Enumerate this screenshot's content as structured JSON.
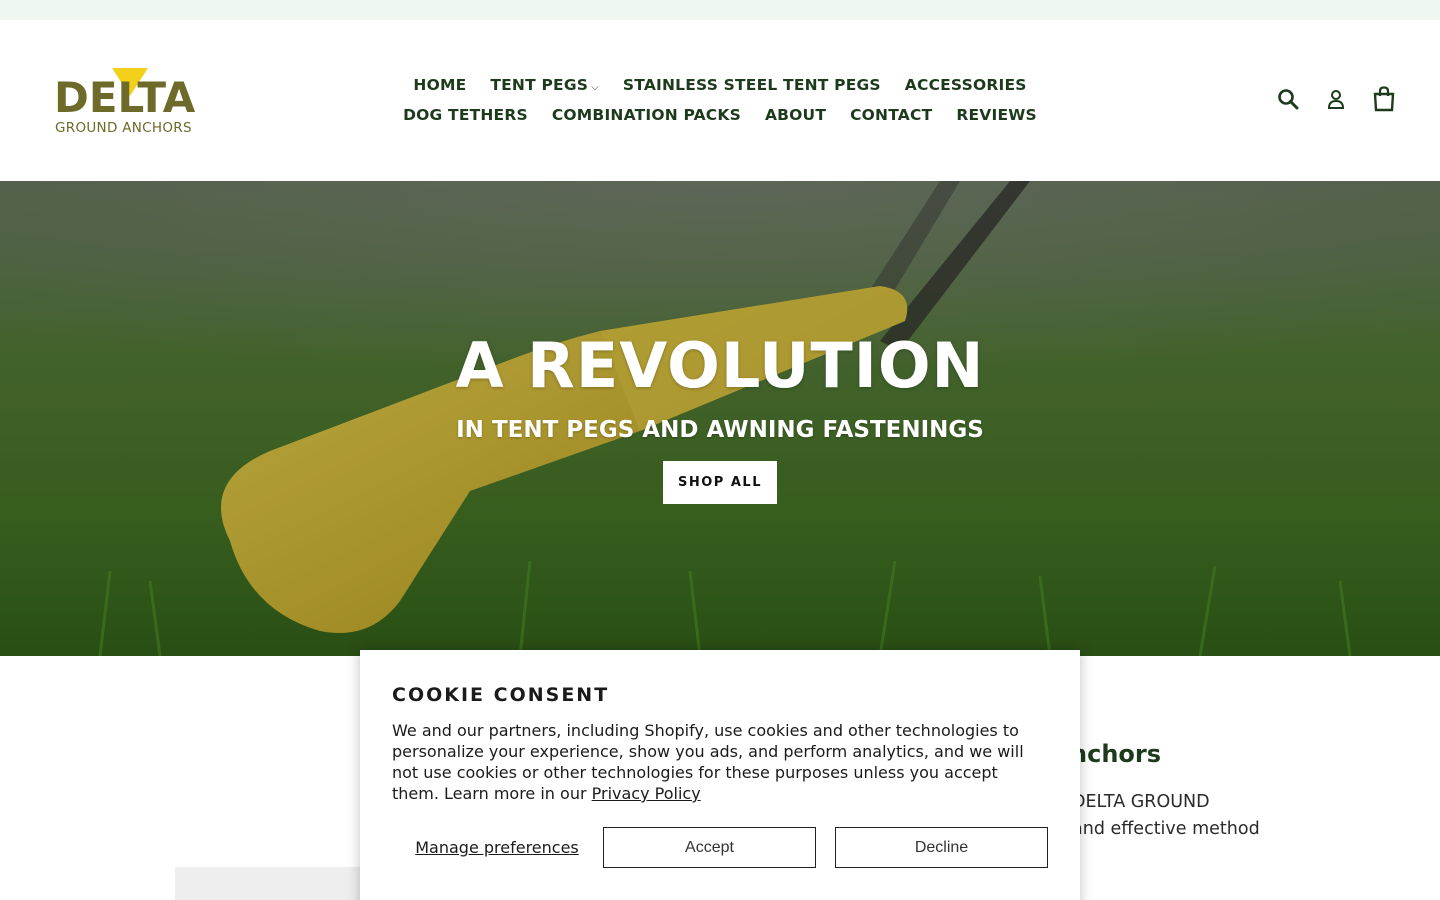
{
  "logo": {
    "wordmark": "DELTA",
    "tagline": "GROUND ANCHORS"
  },
  "nav": {
    "row1": [
      {
        "label": "HOME",
        "dropdown": false
      },
      {
        "label": "TENT PEGS",
        "dropdown": true
      },
      {
        "label": "STAINLESS STEEL TENT PEGS",
        "dropdown": false
      },
      {
        "label": "ACCESSORIES",
        "dropdown": false
      }
    ],
    "row2": [
      {
        "label": "DOG TETHERS",
        "dropdown": false
      },
      {
        "label": "COMBINATION PACKS",
        "dropdown": false
      },
      {
        "label": "ABOUT",
        "dropdown": false
      },
      {
        "label": "CONTACT",
        "dropdown": false
      },
      {
        "label": "REVIEWS",
        "dropdown": false
      }
    ],
    "caret": "⌵"
  },
  "header_icons": [
    "search-icon",
    "account-icon",
    "cart-icon"
  ],
  "hero": {
    "title": "A REVOLUTION",
    "subtitle": "IN TENT PEGS AND AWNING FASTENINGS",
    "button": "SHOP ALL"
  },
  "content": {
    "heading_partial": "nchors",
    "text_line1": "DELTA GROUND",
    "text_line2": "and effective method"
  },
  "cookie": {
    "title": "COOKIE CONSENT",
    "body": "We and our partners, including Shopify, use cookies and other technologies to personalize your experience, show you ads, and perform analytics, and we will not use cookies or other technologies for these purposes unless you accept them. Learn more in our",
    "privacy_link": "Privacy Policy",
    "manage": "Manage preferences",
    "accept": "Accept",
    "decline": "Decline"
  },
  "colors": {
    "nav_text": "#1d3b1c",
    "logo_olive": "#6d6a2a",
    "logo_yellow": "#f3d11b",
    "announcement_bg": "#eef7f0"
  }
}
